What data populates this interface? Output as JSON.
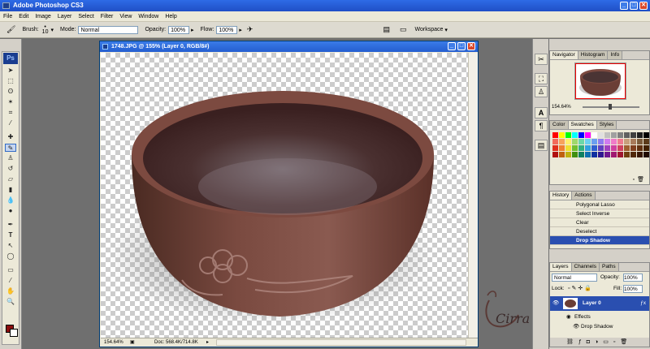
{
  "app": {
    "title": "Adobe Photoshop CS3"
  },
  "menu": [
    "File",
    "Edit",
    "Image",
    "Layer",
    "Select",
    "Filter",
    "View",
    "Window",
    "Help"
  ],
  "options": {
    "brush_label": "Brush:",
    "brush_size": "10",
    "mode_label": "Mode:",
    "mode_value": "Normal",
    "opacity_label": "Opacity:",
    "opacity_value": "100%",
    "flow_label": "Flow:",
    "flow_value": "100%",
    "workspace_label": "Workspace"
  },
  "document": {
    "title": "1748.JPG @ 155% (Layer 0, RGB/8#)",
    "zoom": "154.64%",
    "doc_size": "Doc: 568.4K/714.8K"
  },
  "navigator": {
    "tabs": [
      "Navigator",
      "Histogram",
      "Info"
    ],
    "zoom": "154.64%"
  },
  "swatches": {
    "tabs": [
      "Color",
      "Swatches",
      "Styles"
    ],
    "colors": [
      "#ff0000",
      "#ffff00",
      "#00ff00",
      "#00ffff",
      "#0000ff",
      "#ff00ff",
      "#ffffff",
      "#e0e0e0",
      "#c0c0c0",
      "#a0a0a0",
      "#808080",
      "#606060",
      "#404040",
      "#202020",
      "#000000",
      "#f26b5b",
      "#f7a35c",
      "#fff06b",
      "#9fd86b",
      "#6bd8a8",
      "#6bd0f0",
      "#6b9ff0",
      "#8f7bf0",
      "#d07bf0",
      "#f07bc8",
      "#f07b8f",
      "#c89f7b",
      "#a87b5b",
      "#7b5b3b",
      "#5b3b1b",
      "#e0301e",
      "#f08030",
      "#f0e030",
      "#70c030",
      "#30b080",
      "#30a0e0",
      "#3060d0",
      "#6040c0",
      "#a040c0",
      "#d040a0",
      "#d04060",
      "#a06030",
      "#804020",
      "#603010",
      "#402000",
      "#b01010",
      "#c06010",
      "#c0b010",
      "#409010",
      "#108060",
      "#1070b0",
      "#1030a0",
      "#301890",
      "#701890",
      "#a01870",
      "#a01830",
      "#704010",
      "#502808",
      "#381804",
      "#200c00"
    ]
  },
  "history": {
    "tabs": [
      "History",
      "Actions"
    ],
    "items": [
      "Polygonal Lasso",
      "Select Inverse",
      "Clear",
      "Deselect",
      "Drop Shadow"
    ]
  },
  "layers": {
    "tabs": [
      "Layers",
      "Channels",
      "Paths"
    ],
    "blend_mode": "Normal",
    "opacity_label": "Opacity:",
    "opacity_value": "100%",
    "lock_label": "Lock:",
    "fill_label": "Fill:",
    "fill_value": "100%",
    "layer_name": "Layer 0",
    "effects_label": "Effects",
    "effect_name": "Drop Shadow"
  },
  "signature": "Cirra",
  "colors": {
    "accent": "#245ed0",
    "foreground": "#8b0d0d",
    "background": "#ffffff"
  }
}
